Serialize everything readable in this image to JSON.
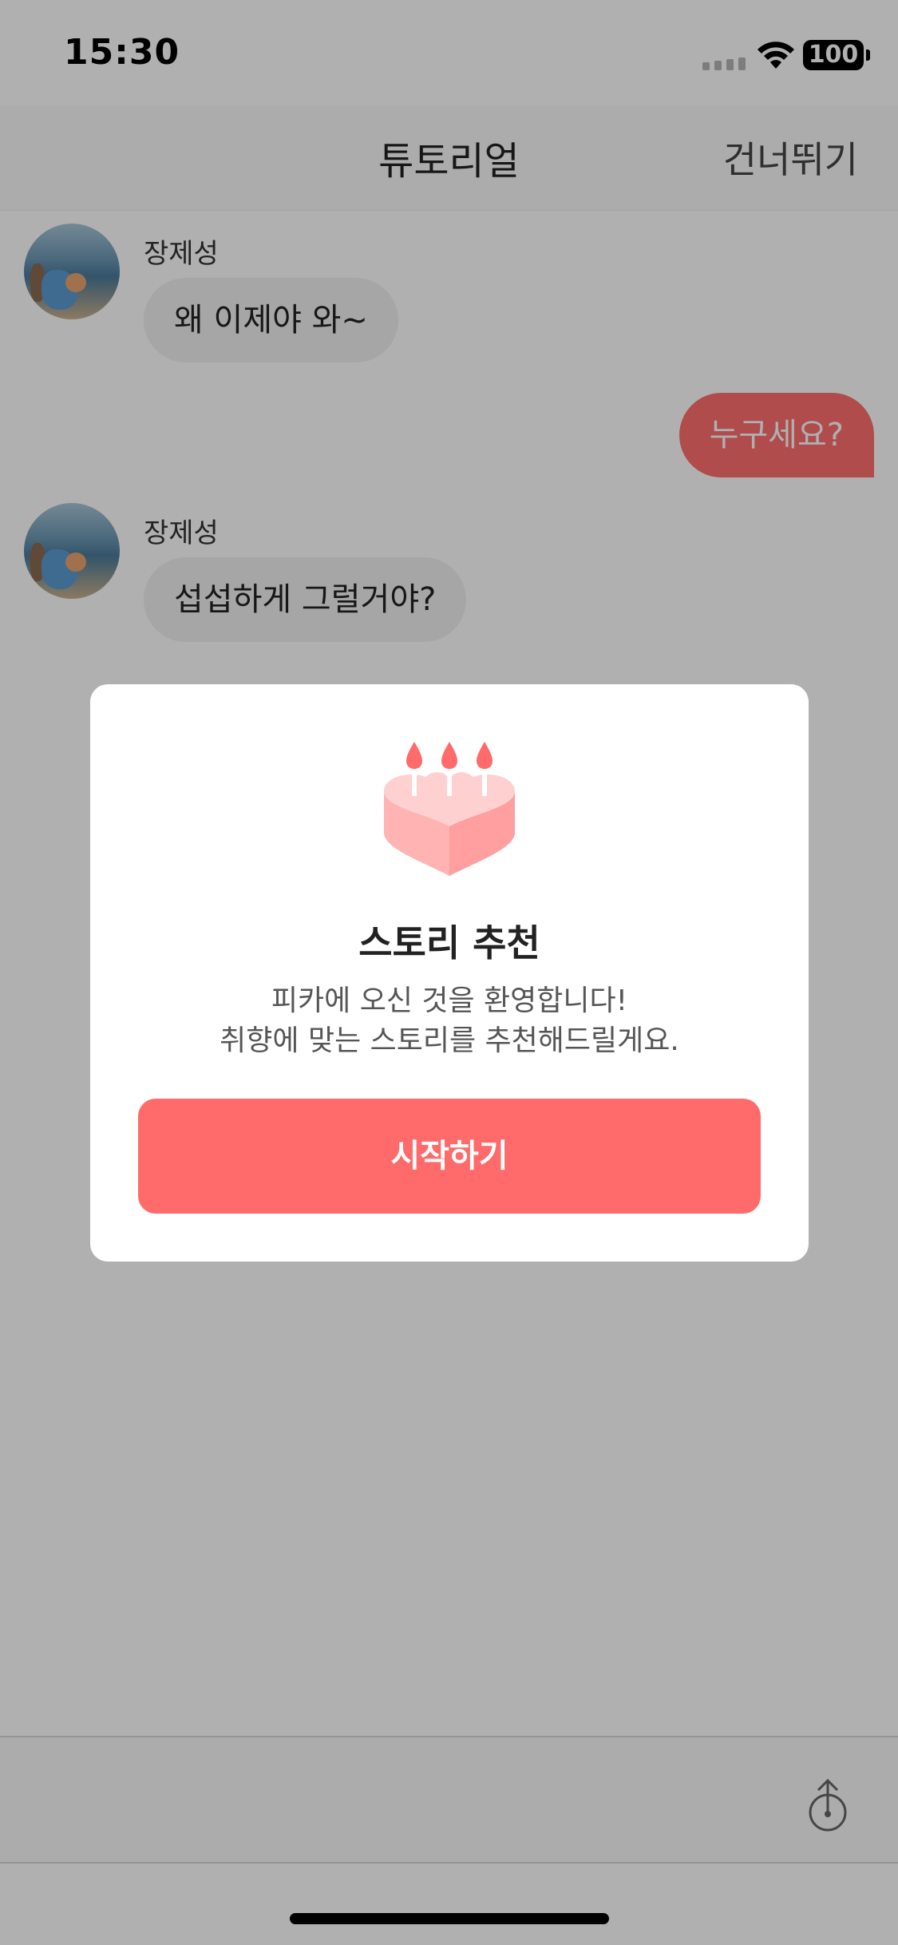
{
  "status_bar": {
    "time": "15:30",
    "battery": "100"
  },
  "nav": {
    "title": "튜토리얼",
    "skip_label": "건너뛰기"
  },
  "chat": {
    "messages": [
      {
        "sender": "장제성",
        "text": "왜 이제야 와~"
      },
      {
        "text": "누구세요?"
      },
      {
        "sender": "장제성",
        "text": "섭섭하게 그럴거야?"
      }
    ]
  },
  "modal": {
    "icon": "heart-cake-with-candles-icon",
    "title": "스토리 추천",
    "description_lines": [
      "피카에 오신 것을 환영합니다!",
      "취향에 맞는 스토리를 추천해드릴게요."
    ],
    "button_label": "시작하기"
  },
  "colors": {
    "accent": "#ff6b6b",
    "outgoing_bubble": "#ff6e6e",
    "incoming_bubble": "#f1f1f1",
    "cake": "#ffc2c2"
  }
}
